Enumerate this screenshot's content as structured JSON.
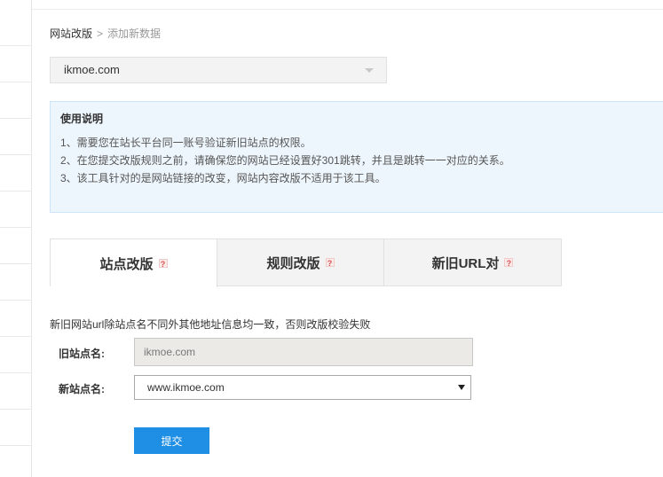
{
  "breadcrumb": {
    "parent": "网站改版",
    "separator": ">",
    "current": "添加新数据"
  },
  "site_selector": {
    "value": "ikmoe.com"
  },
  "notice": {
    "title": "使用说明",
    "items": [
      "1、需要您在站长平台同一账号验证新旧站点的权限。",
      "2、在您提交改版规则之前，请确保您的网站已经设置好301跳转，并且是跳转一一对应的关系。",
      "3、该工具针对的是网站链接的改变，网站内容改版不适用于该工具。"
    ]
  },
  "tabs": [
    {
      "label": "站点改版",
      "help": "?",
      "active": true
    },
    {
      "label": "规则改版",
      "help": "?",
      "active": false
    },
    {
      "label": "新旧URL对",
      "help": "?",
      "active": false
    }
  ],
  "form": {
    "hint": "新旧网站url除站点名不同外其他地址信息均一致，否则改版校验失败",
    "old_site_label": "旧站点名:",
    "old_site_value": "ikmoe.com",
    "new_site_label": "新站点名:",
    "new_site_value": "www.ikmoe.com",
    "submit_label": "提交"
  },
  "colors": {
    "primary_button": "#1f8fe6",
    "notice_background": "#eef6fd",
    "help_badge": "#d9534f"
  }
}
